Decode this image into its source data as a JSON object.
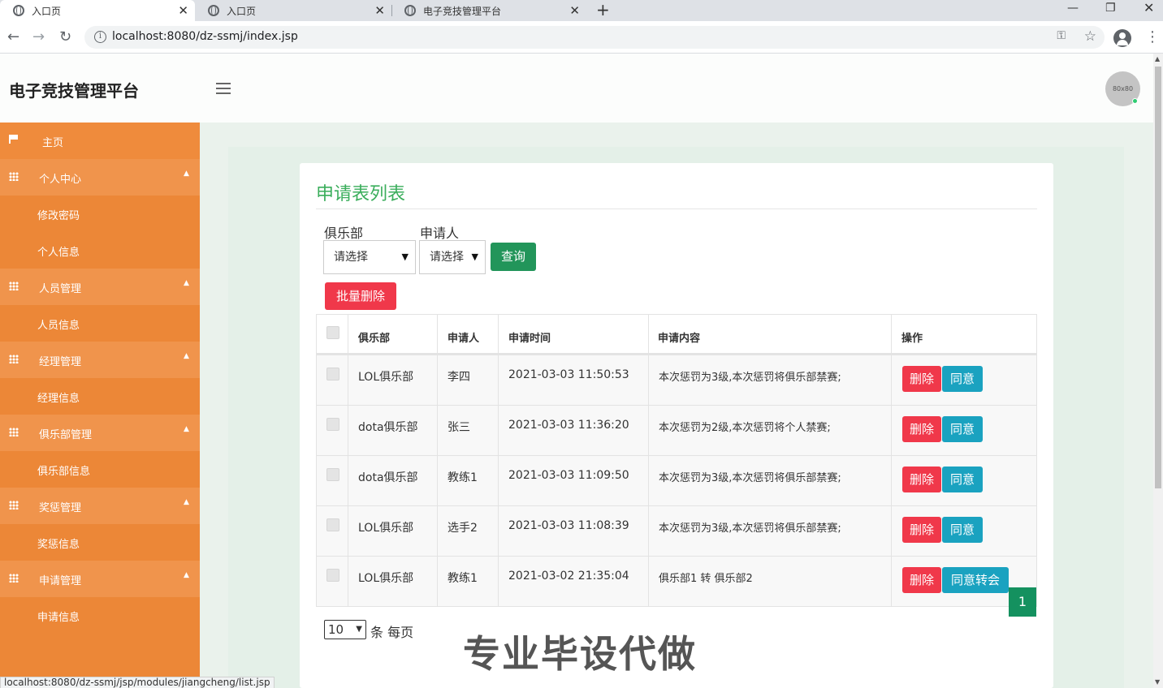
{
  "browser": {
    "tabs": [
      {
        "title": "入口页",
        "active": true
      },
      {
        "title": "入口页",
        "active": false
      },
      {
        "title": "电子竞技管理平台",
        "active": false
      }
    ],
    "url": "localhost:8080/dz-ssmj/index.jsp",
    "status_url": "localhost:8080/dz-ssmj/jsp/modules/jiangcheng/list.jsp"
  },
  "header": {
    "brand": "电子竞技管理平台",
    "avatar_text": "80x80"
  },
  "sidebar": {
    "home": "主页",
    "groups": [
      {
        "label": "个人中心",
        "children": [
          "修改密码",
          "个人信息"
        ]
      },
      {
        "label": "人员管理",
        "children": [
          "人员信息"
        ]
      },
      {
        "label": "经理管理",
        "children": [
          "经理信息"
        ]
      },
      {
        "label": "俱乐部管理",
        "children": [
          "俱乐部信息"
        ]
      },
      {
        "label": "奖惩管理",
        "children": [
          "奖惩信息"
        ]
      },
      {
        "label": "申请管理",
        "children": [
          "申请信息"
        ]
      }
    ]
  },
  "main": {
    "title": "申请表列表",
    "filters": {
      "club_label": "俱乐部",
      "club_value": "请选择",
      "applicant_label": "申请人",
      "applicant_value": "请选择",
      "search_button": "查询"
    },
    "batch_delete": "批量删除",
    "columns": [
      "俱乐部",
      "申请人",
      "申请时间",
      "申请内容",
      "操作"
    ],
    "rows": [
      {
        "club": "LOL俱乐部",
        "applicant": "李四",
        "time": "2021-03-03 11:50:53",
        "content": "本次惩罚为3级,本次惩罚将俱乐部禁赛;",
        "actions": [
          "删除",
          "同意"
        ]
      },
      {
        "club": "dota俱乐部",
        "applicant": "张三",
        "time": "2021-03-03 11:36:20",
        "content": "本次惩罚为2级,本次惩罚将个人禁赛;",
        "actions": [
          "删除",
          "同意"
        ]
      },
      {
        "club": "dota俱乐部",
        "applicant": "教练1",
        "time": "2021-03-03 11:09:50",
        "content": "本次惩罚为3级,本次惩罚将俱乐部禁赛;",
        "actions": [
          "删除",
          "同意"
        ]
      },
      {
        "club": "LOL俱乐部",
        "applicant": "选手2",
        "time": "2021-03-03 11:08:39",
        "content": "本次惩罚为3级,本次惩罚将俱乐部禁赛;",
        "actions": [
          "删除",
          "同意"
        ]
      },
      {
        "club": "LOL俱乐部",
        "applicant": "教练1",
        "time": "2021-03-02 21:35:04",
        "content": "俱乐部1 转 俱乐部2",
        "actions": [
          "删除",
          "同意转会"
        ]
      }
    ],
    "pager": {
      "page_size": "10",
      "page_size_suffix": "条 每页",
      "current_page": "1"
    },
    "watermark": "专业毕设代做"
  },
  "colors": {
    "sidebar": "#ec8737",
    "title": "#3bae5c",
    "search_button": "#22955a",
    "delete": "#f0384a",
    "approve": "#1aa2c0",
    "page_active": "#14915f"
  }
}
